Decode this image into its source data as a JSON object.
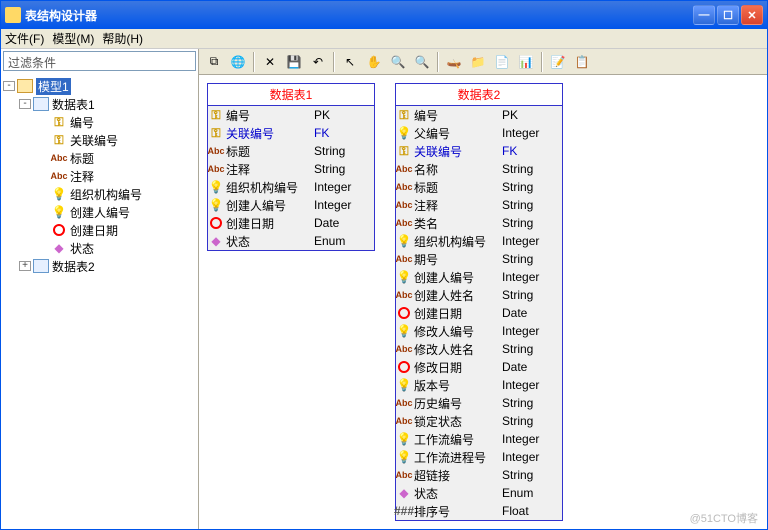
{
  "title": "表结构设计器",
  "menu": {
    "file": "文件(F)",
    "model": "模型(M)",
    "help": "帮助(H)"
  },
  "filter_placeholder": "过滤条件",
  "tree": {
    "root": "模型1",
    "t1": "数据表1",
    "t1_fields": [
      "编号",
      "关联编号",
      "标题",
      "注释",
      "组织机构编号",
      "创建人编号",
      "创建日期",
      "状态"
    ],
    "t2": "数据表2"
  },
  "table1": {
    "title": "数据表1",
    "rows": [
      {
        "icon": "key",
        "name": "编号",
        "type": "PK"
      },
      {
        "icon": "key",
        "name": "关联编号",
        "type": "FK",
        "fk": true
      },
      {
        "icon": "abc",
        "name": "标题",
        "type": "String"
      },
      {
        "icon": "abc",
        "name": "注释",
        "type": "String"
      },
      {
        "icon": "bulb",
        "name": "组织机构编号",
        "type": "Integer"
      },
      {
        "icon": "bulb",
        "name": "创建人编号",
        "type": "Integer"
      },
      {
        "icon": "clock",
        "name": "创建日期",
        "type": "Date"
      },
      {
        "icon": "diamond",
        "name": "状态",
        "type": "Enum"
      }
    ]
  },
  "table2": {
    "title": "数据表2",
    "rows": [
      {
        "icon": "key",
        "name": "编号",
        "type": "PK"
      },
      {
        "icon": "bulb",
        "name": "父编号",
        "type": "Integer"
      },
      {
        "icon": "key",
        "name": "关联编号",
        "type": "FK",
        "fk": true
      },
      {
        "icon": "abc",
        "name": "名称",
        "type": "String"
      },
      {
        "icon": "abc",
        "name": "标题",
        "type": "String"
      },
      {
        "icon": "abc",
        "name": "注释",
        "type": "String"
      },
      {
        "icon": "abc",
        "name": "类名",
        "type": "String"
      },
      {
        "icon": "bulb",
        "name": "组织机构编号",
        "type": "Integer"
      },
      {
        "icon": "abc",
        "name": "期号",
        "type": "String"
      },
      {
        "icon": "bulb",
        "name": "创建人编号",
        "type": "Integer"
      },
      {
        "icon": "abc",
        "name": "创建人姓名",
        "type": "String"
      },
      {
        "icon": "clock",
        "name": "创建日期",
        "type": "Date"
      },
      {
        "icon": "bulb",
        "name": "修改人编号",
        "type": "Integer"
      },
      {
        "icon": "abc",
        "name": "修改人姓名",
        "type": "String"
      },
      {
        "icon": "clock",
        "name": "修改日期",
        "type": "Date"
      },
      {
        "icon": "bulb",
        "name": "版本号",
        "type": "Integer"
      },
      {
        "icon": "abc",
        "name": "历史编号",
        "type": "String"
      },
      {
        "icon": "abc",
        "name": "锁定状态",
        "type": "String"
      },
      {
        "icon": "bulb",
        "name": "工作流编号",
        "type": "Integer"
      },
      {
        "icon": "bulb",
        "name": "工作流进程号",
        "type": "Integer"
      },
      {
        "icon": "abc",
        "name": "超链接",
        "type": "String"
      },
      {
        "icon": "diamond",
        "name": "状态",
        "type": "Enum"
      },
      {
        "icon": "hash",
        "name": "排序号",
        "type": "Float"
      }
    ]
  },
  "watermark": "@51CTO博客"
}
